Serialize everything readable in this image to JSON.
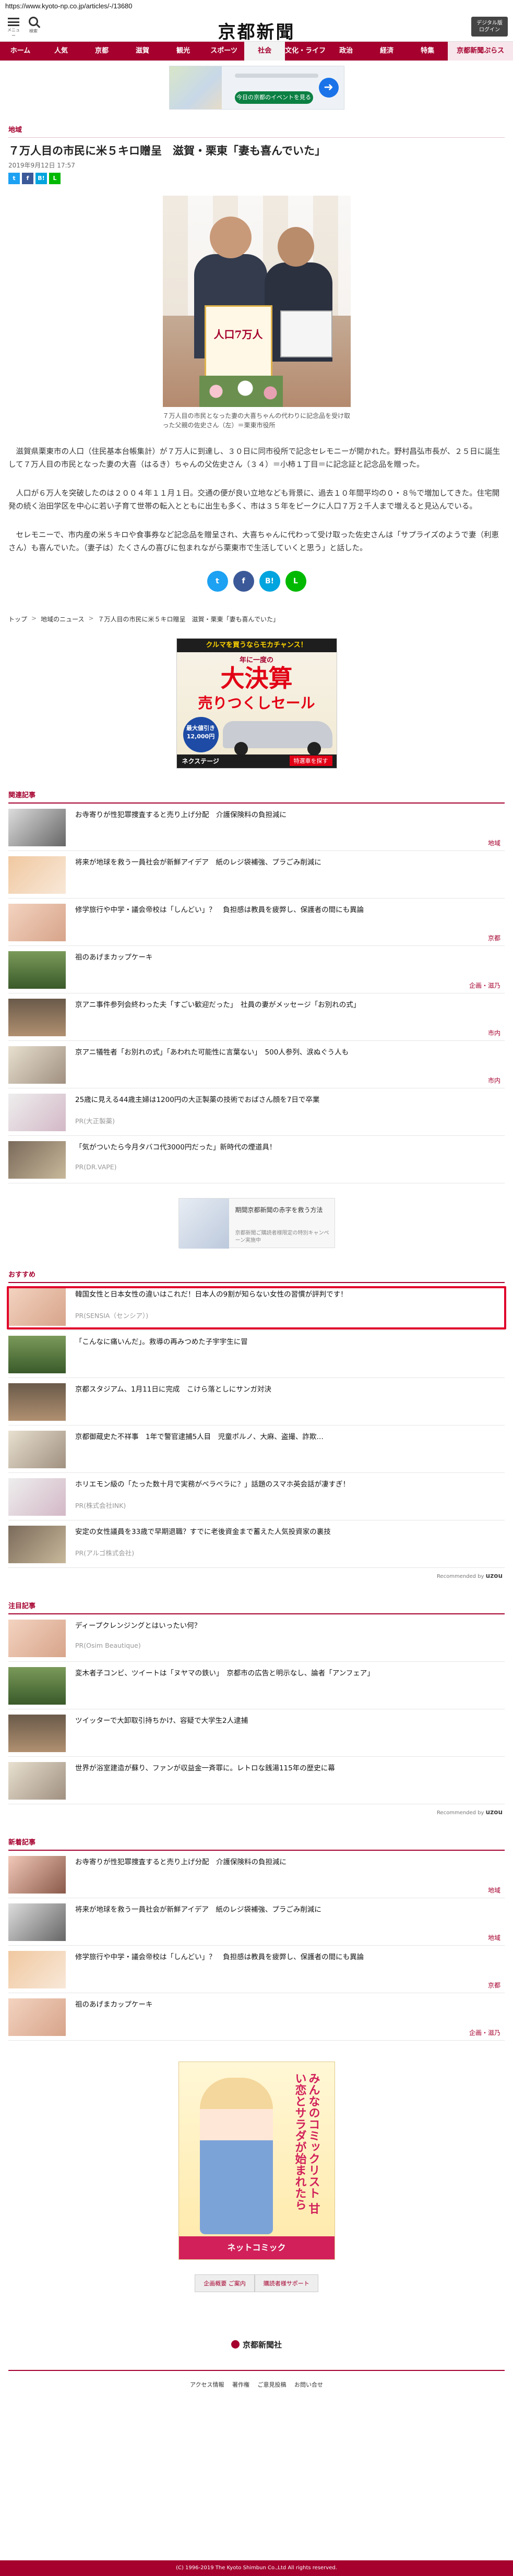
{
  "browser": {
    "url": "https://www.kyoto-np.co.jp/articles/-/13680"
  },
  "header": {
    "menu_label": "メニュー",
    "search_label": "検索",
    "logo": "京都新聞",
    "login_line1": "デジタル版",
    "login_line2": "ログイン"
  },
  "nav": {
    "items": [
      "ホーム",
      "人気",
      "京都",
      "滋賀",
      "観光",
      "スポーツ",
      "社会",
      "文化・ライフ",
      "政治",
      "経済",
      "特集",
      "京都新聞ぷらス"
    ],
    "active": "社会"
  },
  "ad_top": {
    "button": "今日の京都のイベントを見る",
    "icon": "arrow-right-icon"
  },
  "article": {
    "category": "地域",
    "title": "７万人目の市民に米５キロ贈呈　滋賀・栗東「妻も喜んでいた」",
    "date": "2019年9月12日 17:57",
    "share": [
      "Twitter",
      "Facebook",
      "はてな",
      "LINE"
    ],
    "photo_board": "人口7万人",
    "caption": "７万人目の市民となった妻の大喜ちゃんの代わりに記念品を受け取った父親の佐史さん（左）＝栗東市役所",
    "paragraphs": [
      "滋賀県栗東市の人口（住民基本台帳集計）が７万人に到達し、３０日に同市役所で記念セレモニーが開かれた。野村昌弘市長が、２５日に誕生して７万人目の市民となった妻の大喜（はるき）ちゃんの父佐史さん（３４）＝小柿１丁目＝に記念証と記念品を贈った。",
      "人口が６万人を突破したのは２００４年１１月１日。交通の便が良い立地なども背景に、過去１０年間平均の０・８％で増加してきた。住宅開発の続く治田学区を中心に若い子育て世帯の転入とともに出生も多く、市は３５年をピークに人口７万２千人まで増えると見込んでいる。",
      "セレモニーで、市内産の米５キロや食事券など記念品を贈呈され、大喜ちゃんに代わって受け取った佐史さんは「サプライズのようで妻（利恵さん）も喜んでいた。（妻子は）たくさんの喜びに包まれながら栗東市で生活していくと思う」と話した。"
    ]
  },
  "breadcrumb": [
    "トップ",
    "地域のニュース",
    "７万人目の市民に米５キロ贈呈　滋賀・栗東「妻も喜んでいた」"
  ],
  "ad_mid": {
    "top": "クルマを買うならモカチャンス！",
    "sub": "年に一度の",
    "big1": "大決算",
    "big2": "売りつくしセール",
    "coin": "最大値引き 12,000円",
    "brand": "ネクステージ",
    "cta": "特選車を探す"
  },
  "related": {
    "head": "関連記事",
    "items": [
      {
        "title": "お寺寄りが性犯罪捜査すると売り上げ分配　介護保険料の負担減に",
        "cat": "地域"
      },
      {
        "title": "将来が地球を救う一員社会が新鮮アイデア　紙のレジ袋補強、プラごみ削減に",
        "cat": ""
      },
      {
        "title": "修学旅行や中学・議会帝校は「しんどい」？　負担感は教員を疲弊し、保護者の間にも異論",
        "cat": "京都"
      },
      {
        "title": "祖のあげまカップケーキ",
        "cat": "企画・滋乃"
      },
      {
        "title": "京アニ事件参列会終わった夫「すごい歓迎だった」　社員の妻がメッセージ「お別れの式」",
        "cat": "市内"
      },
      {
        "title": "京アニ犠牲者「お別れの式」「あわれた可能性に言葉ない」　500人参列、涙ぬぐう人も",
        "cat": "市内"
      },
      {
        "title": "25歳に見える44歳主婦は1200円の大正製薬の技術でおばさん顔を7日で卒業",
        "pr": "PR(大正製薬)"
      },
      {
        "title": "「気がついたら今月タバコ代3000円だった」新時代の煙道具！",
        "pr": "PR(DR.VAPE)"
      }
    ]
  },
  "ad_small": {
    "t1": "期間京都新聞の赤字を救う方法",
    "t2": "京都新聞ご購読者様限定の特別キャンペーン実施中"
  },
  "recommend": {
    "head": "おすすめ",
    "items": [
      {
        "title": "韓国女性と日本女性の違いはこれだ！日本人の9割が知らない女性の習慣が評判です！",
        "pr": "PR(SENSIA（センシア）)",
        "highlight": true
      },
      {
        "title": "「こんなに痛いんだ」。救導の再みつめた子宇宇生に冒",
        "pr": ""
      },
      {
        "title": "京都スタジアム、1月11日に完成　こけら落としにサンガ対決",
        "pr": ""
      },
      {
        "title": "京都御蔵史た不祥事　1年で警官逮捕5人目　児童ポルノ、大麻、盗撮、詐欺…",
        "pr": ""
      },
      {
        "title": "ホリエモン級の「たった数十月で実務がベラベラに？」話題のスマホ英会話が凄すぎ！",
        "pr": "PR(株式会社INK)"
      },
      {
        "title": "安定の女性議員を33歳で早期退職？すでに老後資金まで蓄えた人気投資家の裏技",
        "pr": "PR(アルゴ株式会社)"
      }
    ],
    "powered_by": "Recommended by",
    "powered_brand": "uzou"
  },
  "attention": {
    "head": "注目記事",
    "items": [
      {
        "title": "ディープクレンジングとはいったい何？",
        "pr": "PR(Osim Beautique)"
      },
      {
        "title": "変木者子コンビ、ツイートは「ヌヤマの鉄い」　京都市の広告と明示なし、論者「アンフェア」",
        "pr": ""
      },
      {
        "title": "ツイッターで大卸取引持ちかけ、容疑で大学生2人逮捕",
        "pr": ""
      },
      {
        "title": "世界が浴室建造が蘇り、ファンが収益金一斉罪に。レトロな銭湯115年の歴史に幕",
        "pr": ""
      }
    ],
    "powered_by": "Recommended by",
    "powered_brand": "uzou"
  },
  "latest": {
    "head": "新着記事",
    "items": [
      {
        "title": "お寺寄りが性犯罪捜査すると売り上げ分配　介護保険料の負担減に",
        "cat": "地域"
      },
      {
        "title": "将来が地球を救う一員社会が新鮮アイデア　紙のレジ袋補強、プラごみ削減に",
        "cat": "地域"
      },
      {
        "title": "修学旅行や中学・議会帝校は「しんどい」？　負担感は教員を疲弊し、保護者の間にも異論",
        "cat": "京都"
      },
      {
        "title": "祖のあげまカップケーキ",
        "cat": "企画・滋乃"
      }
    ]
  },
  "ad_bottom": {
    "text": "みんなのコミックリスト 甘い恋とサラダが始まれたら",
    "badge": "ネットコミック"
  },
  "footer": {
    "links": [
      "企画概要 ご案内",
      "購読者様サポート"
    ],
    "logo": "京都新聞社",
    "bar": "アクセス情報 著作権 ご意見投稿 お問い合せ",
    "copyright": "(C) 1996-2019 The Kyoto Shimbun Co.,Ltd All rights reserved."
  }
}
